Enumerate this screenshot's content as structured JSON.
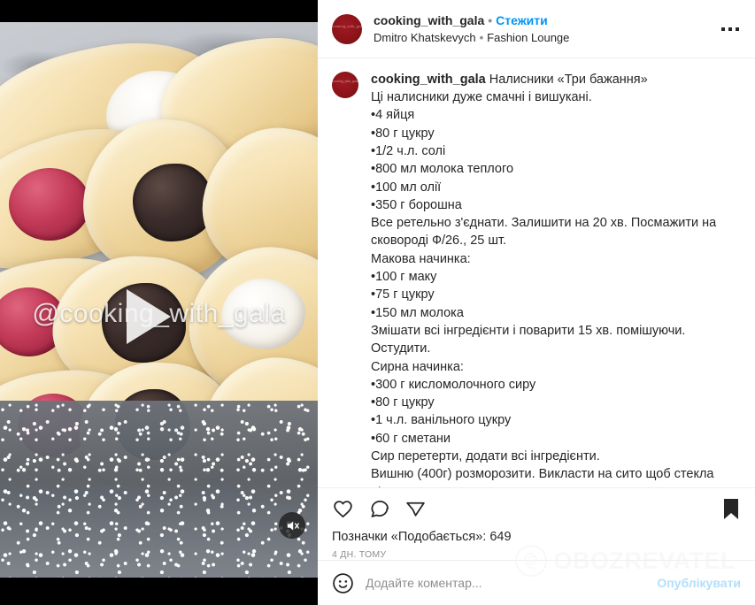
{
  "media": {
    "watermark_text": "@cooking_with_gala",
    "play_icon": "play-icon",
    "mute_icon": "muted-speaker-icon",
    "is_muted": true
  },
  "header": {
    "username": "cooking_with_gala",
    "separator": "•",
    "follow_label": "Стежити",
    "subtitle_author": "Dmitro Khatskevych",
    "subtitle_separator": "•",
    "subtitle_location": "Fashion Lounge",
    "menu_icon": "more-options-icon",
    "avatar_text": "cooking_with_gala"
  },
  "caption": {
    "username": "cooking_with_gala",
    "title": "Налисники «Три бажання»",
    "body": "Ці налисники дуже смачні і вишукані.\n•4 яйця\n•80 г цукру\n•1/2 ч.л. солі\n•800 мл молока теплого\n•100 мл олії\n•350 г борошна\nВсе ретельно з'єднати. Залишити на 20 хв. Посмажити на сковороді Ф/26., 25 шт.\nМакова начинка:\n•100 г маку\n•75 г цукру\n•150 мл молока\nЗмішати всі інгредієнти і поварити 15 хв. помішуючи. Остудити.\nСирна начинка:\n•300 г кисломолочного сиру\n•80 г цукру\n•1 ч.л. ванільного цукру\n•60 г сметани\nСир перетерти, додати всі інгредієнти.\nВишню (400г) розморозити. Викласти на сито щоб стекла рідина."
  },
  "actions": {
    "like_icon": "heart-icon",
    "comment_icon": "comment-bubble-icon",
    "share_icon": "share-paper-plane-icon",
    "save_icon": "bookmark-filled-icon",
    "is_saved": true
  },
  "stats": {
    "likes_label": "Позначки «Подобається»: 649",
    "likes_count": 649,
    "timestamp": "4 дн. тому"
  },
  "comment_bar": {
    "emoji_icon": "emoji-smiley-icon",
    "placeholder": "Додайте коментар...",
    "value": "",
    "post_label": "Опублікувати"
  },
  "watermark": {
    "brand": "OBOZREVATEL",
    "logo_icon": "globe-hand-logo-icon"
  },
  "colors": {
    "link_blue": "#0095f6",
    "post_blue_disabled": "#b2dffc",
    "text_primary": "#262626",
    "text_muted": "#8e8e8e",
    "divider": "#efefef",
    "avatar_red": "#8c1419"
  }
}
